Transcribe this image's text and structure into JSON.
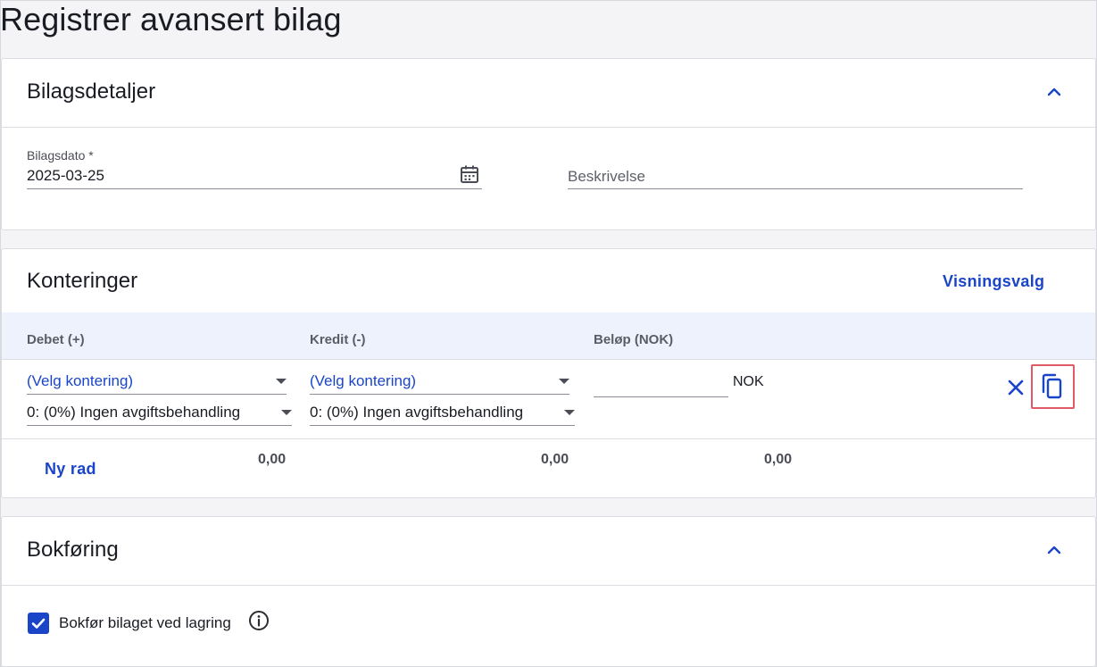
{
  "page": {
    "title": "Registrer avansert bilag"
  },
  "details": {
    "title": "Bilagsdetaljer",
    "date_label": "Bilagsdato *",
    "date_value": "2025-03-25",
    "description_placeholder": "Beskrivelse",
    "collapse_icon": "chevron-up-icon",
    "date_icon": "calendar-icon"
  },
  "konteringer": {
    "title": "Konteringer",
    "view_options_label": "Visningsvalg",
    "headers": {
      "debet": "Debet (+)",
      "kredit": "Kredit (-)",
      "belop": "Beløp (NOK)"
    },
    "row": {
      "debet_account": "(Velg kontering)",
      "debet_vat": "0: (0%) Ingen avgiftsbehandling",
      "kredit_account": "(Velg kontering)",
      "kredit_vat": "0: (0%) Ingen avgiftsbehandling",
      "amount": "",
      "currency": "NOK",
      "delete_icon": "close-icon",
      "copy_icon": "copy-icon"
    },
    "new_row_label": "Ny rad",
    "totals": {
      "debet": "0,00",
      "kredit": "0,00",
      "belop": "0,00"
    }
  },
  "bokforing": {
    "title": "Bokføring",
    "checkbox_label": "Bokfør bilaget ved lagring",
    "checkbox_checked": true,
    "info_icon": "info-icon",
    "collapse_icon": "chevron-up-icon"
  },
  "colors": {
    "accent": "#1a45c8",
    "header_band": "#eef2fc",
    "highlight": "#e05a66"
  }
}
